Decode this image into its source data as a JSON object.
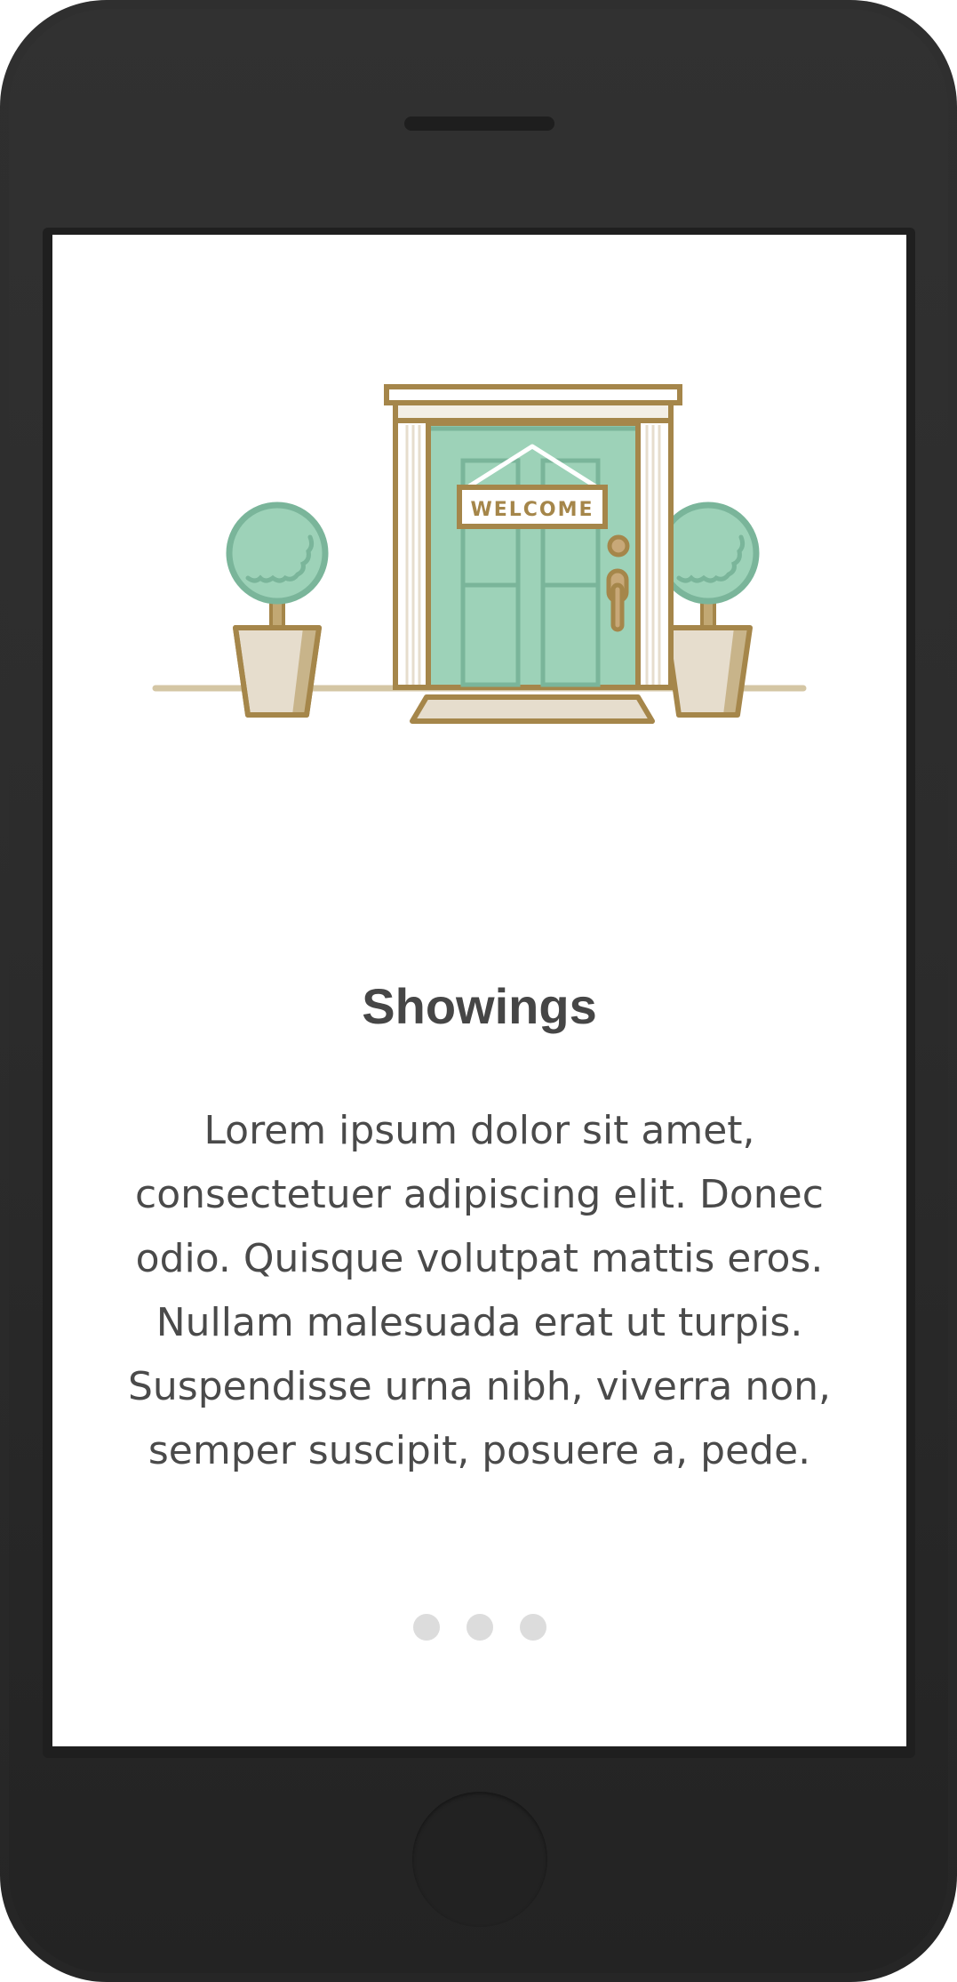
{
  "screen": {
    "title": "Showings",
    "body": "Lorem ipsum dolor sit amet, consectetuer adipiscing elit. Donec odio. Quisque volutpat mattis eros. Nullam malesuada erat ut turpis. Suspendisse urna nibh, viverra non, semper suscipit, posuere a, pede.",
    "illustration": {
      "sign_text": "WELCOME",
      "icon": "front-door-illustration"
    },
    "pagination": {
      "count": 3,
      "active_index": null
    }
  },
  "colors": {
    "device": "#2d2d2d",
    "screen_background": "#ffffff",
    "door_green": "#9dd2b8",
    "door_panel_stroke": "#7ab59a",
    "outline_gold": "#a5864a",
    "pot_fill": "#e6ddcd",
    "title_text": "#464646",
    "body_text": "#4a4a4a",
    "dot_inactive": "#dcdcdc"
  }
}
